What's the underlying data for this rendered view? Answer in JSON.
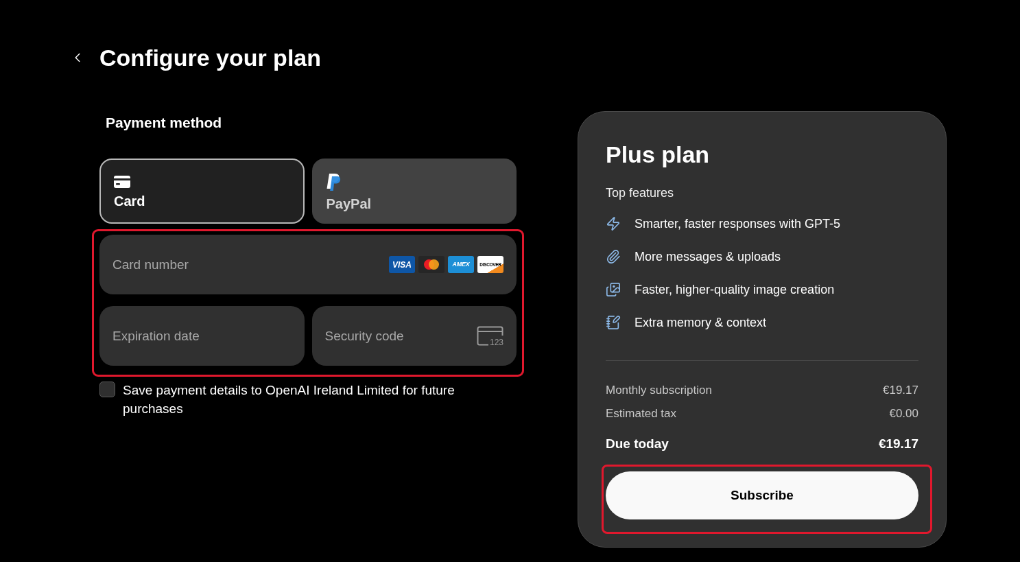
{
  "header": {
    "title": "Configure your plan"
  },
  "payment": {
    "heading": "Payment method",
    "methods": [
      {
        "kind": "card",
        "label": "Card",
        "selected": true
      },
      {
        "kind": "paypal",
        "label": "PayPal",
        "selected": false
      }
    ],
    "fields": {
      "highlighted": true,
      "card_number": {
        "placeholder": "Card number",
        "brands": [
          {
            "kind": "visa",
            "label": "VISA"
          },
          {
            "kind": "mastercard"
          },
          {
            "kind": "amex",
            "label": "AMEX"
          },
          {
            "kind": "discover",
            "label": "DISCOVER"
          }
        ]
      },
      "expiration": {
        "placeholder": "Expiration date"
      },
      "security_code": {
        "placeholder": "Security code",
        "icon_label": "123"
      }
    },
    "save_details": {
      "label": "Save payment details to OpenAI Ireland Limited for future purchases",
      "checked": false
    }
  },
  "plan": {
    "title": "Plus plan",
    "features_heading": "Top features",
    "features": [
      "Smarter, faster responses with GPT-5",
      "More messages & uploads",
      "Faster, higher-quality image creation",
      "Extra memory & context"
    ],
    "lines": [
      {
        "kind": "item",
        "label": "Monthly subscription",
        "value": "€19.17"
      },
      {
        "kind": "item",
        "label": "Estimated tax",
        "value": "€0.00"
      },
      {
        "kind": "total",
        "label": "Due today",
        "value": "€19.17"
      }
    ],
    "subscribe": {
      "label": "Subscribe",
      "highlighted": true
    }
  }
}
